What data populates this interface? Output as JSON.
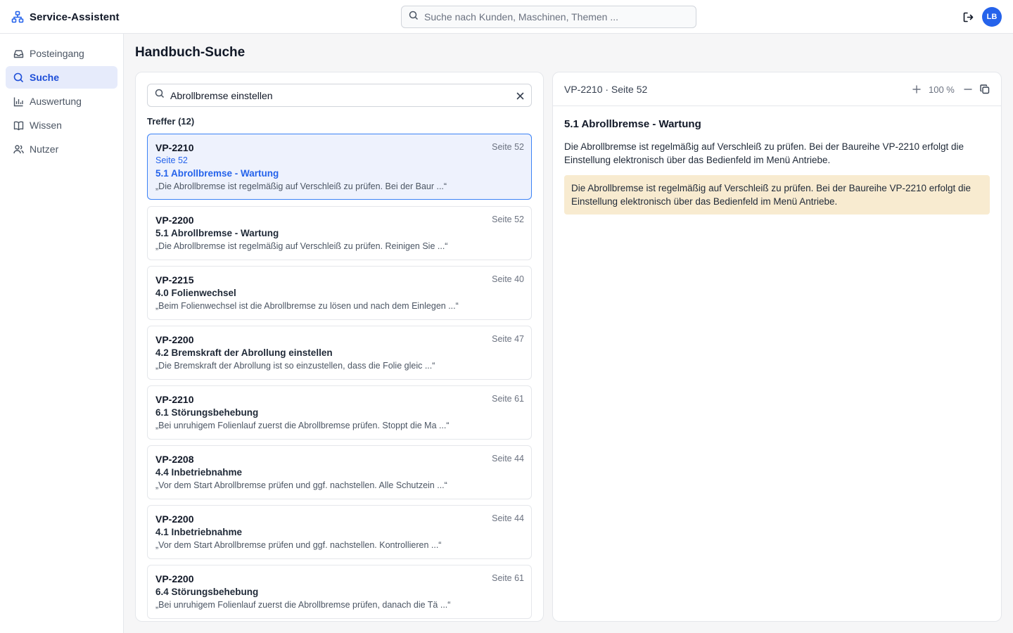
{
  "app": {
    "title": "Service-Assistent",
    "search_placeholder": "Suche nach Kunden, Maschinen, Themen ...",
    "user_initials": "LB",
    "colors": {
      "accent": "#2563eb",
      "highlight": "#f8ebd0",
      "active_bg": "#e6ebfb"
    }
  },
  "sidebar": {
    "items": [
      {
        "label": "Posteingang",
        "icon": "inbox-icon",
        "active": false
      },
      {
        "label": "Suche",
        "icon": "search-icon",
        "active": true
      },
      {
        "label": "Auswertung",
        "icon": "bar-chart-icon",
        "active": false
      },
      {
        "label": "Wissen",
        "icon": "book-icon",
        "active": false
      },
      {
        "label": "Nutzer",
        "icon": "users-icon",
        "active": false
      }
    ]
  },
  "main": {
    "page_title": "Handbuch-Suche",
    "search_value": "Abrollbremse einstellen",
    "hits_label": "Treffer (12)",
    "results": [
      {
        "model": "VP-2210",
        "page": "Seite 52",
        "sub": "Seite 52",
        "heading": "5.1 Abrollbremse - Wartung",
        "snippet": "„Die Abrollbremse ist regelmäßig auf Verschleiß zu prüfen. Bei der Baur ...“",
        "active": true
      },
      {
        "model": "VP-2200",
        "page": "Seite 52",
        "heading": "5.1 Abrollbremse - Wartung",
        "snippet": "„Die Abrollbremse ist regelmäßig auf Verschleiß zu prüfen. Reinigen Sie ...“"
      },
      {
        "model": "VP-2215",
        "page": "Seite 40",
        "heading": "4.0 Folienwechsel",
        "snippet": "„Beim Folienwechsel ist die Abrollbremse zu lösen und nach dem Einlegen ...“"
      },
      {
        "model": "VP-2200",
        "page": "Seite 47",
        "heading": "4.2 Bremskraft der Abrollung einstellen",
        "snippet": "„Die Bremskraft der Abrollung ist so einzustellen, dass die Folie gleic ...“"
      },
      {
        "model": "VP-2210",
        "page": "Seite 61",
        "heading": "6.1 Störungsbehebung",
        "snippet": "„Bei unruhigem Folienlauf zuerst die Abrollbremse prüfen. Stoppt die Ma ...“"
      },
      {
        "model": "VP-2208",
        "page": "Seite 44",
        "heading": "4.4 Inbetriebnahme",
        "snippet": "„Vor dem Start Abrollbremse prüfen und ggf. nachstellen. Alle Schutzein ...“"
      },
      {
        "model": "VP-2200",
        "page": "Seite 44",
        "heading": "4.1 Inbetriebnahme",
        "snippet": "„Vor dem Start Abrollbremse prüfen und ggf. nachstellen. Kontrollieren ...“"
      },
      {
        "model": "VP-2200",
        "page": "Seite 61",
        "heading": "6.4 Störungsbehebung",
        "snippet": "„Bei unruhigem Folienlauf zuerst die Abrollbremse prüfen, danach die Tä ...“"
      }
    ]
  },
  "viewer": {
    "title": "VP-2210 · Seite 52",
    "zoom": "100 %",
    "heading": "5.1 Abrollbremse - Wartung",
    "text": "Die Abrollbremse ist regelmäßig auf Verschleiß zu prüfen. Bei der Baureihe VP-2210 erfolgt die Einstellung elektronisch über das Bedienfeld im Menü Antriebe.",
    "highlight": "Die Abrollbremse ist regelmäßig auf Verschleiß zu prüfen. Bei der Baureihe VP-2210 erfolgt die Einstellung elektronisch über das Bedienfeld im Menü Antriebe."
  }
}
